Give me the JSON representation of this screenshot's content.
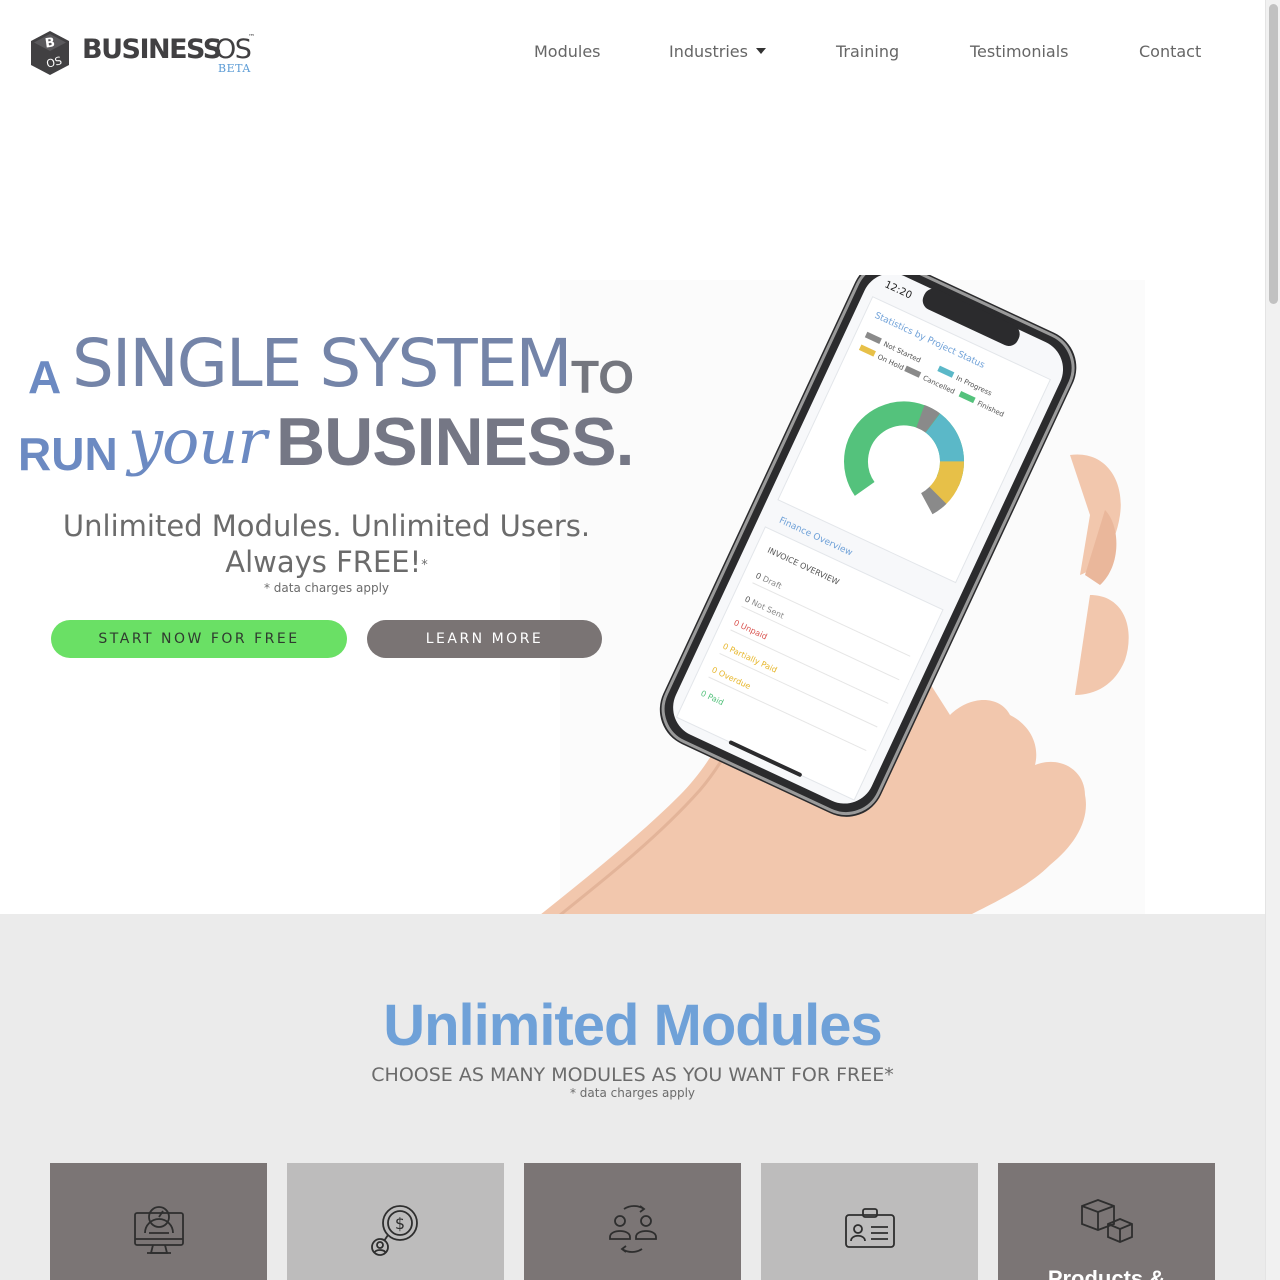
{
  "header": {
    "logo": {
      "word_bold": "BUSINESS",
      "word_light": "OS",
      "tm": "™",
      "badge": "BETA",
      "mark_letters": "B OS"
    },
    "nav": [
      {
        "label": "Modules",
        "has_dropdown": false
      },
      {
        "label": "Industries",
        "has_dropdown": true
      },
      {
        "label": "Training",
        "has_dropdown": false
      },
      {
        "label": "Testimonials",
        "has_dropdown": false
      },
      {
        "label": "Contact",
        "has_dropdown": false
      }
    ]
  },
  "hero": {
    "headline": {
      "a": "A",
      "single_system": "SINGLE SYSTEM",
      "to": "TO",
      "run": "RUN",
      "your": "your",
      "business": "BUSINESS."
    },
    "subhead_line1": "Unlimited Modules. Unlimited Users.",
    "subhead_line2": "Always FREE!",
    "subhead_asterisk": "*",
    "note": "* data charges apply",
    "start_button": "START NOW FOR FREE",
    "learn_button": "LEARN MORE",
    "phone_screen": {
      "time": "12:20",
      "stats_title": "Statistics by Project Status",
      "legend": [
        "Not Started",
        "In Progress",
        "On Hold",
        "Cancelled",
        "Finished"
      ],
      "finance_title": "Finance Overview",
      "invoice_title": "INVOICE OVERVIEW",
      "invoice_rows": [
        {
          "count": "0",
          "label": "Draft"
        },
        {
          "count": "0",
          "label": "Not Sent"
        },
        {
          "count": "0",
          "label": "Unpaid"
        },
        {
          "count": "0",
          "label": "Partially Paid"
        },
        {
          "count": "0",
          "label": "Overdue"
        },
        {
          "count": "0",
          "label": "Paid"
        }
      ]
    }
  },
  "modules": {
    "title": "Unlimited Modules",
    "subtitle": "CHOOSE AS MANY MODULES AS YOU WANT FOR FREE*",
    "note": "* data charges apply",
    "cards": [
      {
        "icon": "dashboard-monitor-icon",
        "label": ""
      },
      {
        "icon": "finance-user-icon",
        "label": ""
      },
      {
        "icon": "users-sync-icon",
        "label": ""
      },
      {
        "icon": "id-card-icon",
        "label": ""
      },
      {
        "icon": "boxes-icon",
        "label": "Products &"
      }
    ]
  },
  "colors": {
    "accent_blue": "#6fa1d8",
    "start_green": "#6ae065",
    "learn_grey": "#7a7474",
    "card_dark": "#7b7575",
    "card_light": "#bdbcbc",
    "section_bg": "#ebebeb"
  }
}
